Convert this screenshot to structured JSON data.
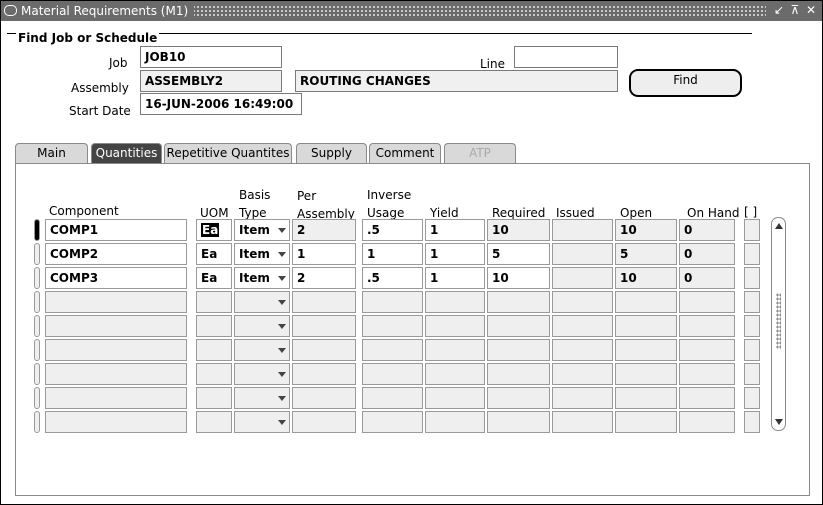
{
  "window": {
    "title": "Material Requirements (M1)",
    "controls": [
      "↙",
      "⊼",
      "✕"
    ]
  },
  "find_group": {
    "title": "Find Job or Schedule",
    "job_label": "Job",
    "job_value": "JOB10",
    "line_label": "Line",
    "line_value": "",
    "assembly_label": "Assembly",
    "assembly_value": "ASSEMBLY2",
    "assembly_desc": "ROUTING CHANGES",
    "start_date_label": "Start Date",
    "start_date_value": "16-JUN-2006 16:49:00",
    "find_button": "Find"
  },
  "tabs": [
    {
      "label": "Main",
      "state": "normal"
    },
    {
      "label": "Quantities",
      "state": "active"
    },
    {
      "label": "Repetitive Quantites",
      "state": "normal"
    },
    {
      "label": "Supply",
      "state": "normal"
    },
    {
      "label": "Comment",
      "state": "normal"
    },
    {
      "label": "ATP",
      "state": "disabled"
    }
  ],
  "table": {
    "headers": {
      "component": "Component",
      "uom": "UOM",
      "basis_type_1": "Basis",
      "basis_type_2": "Type",
      "per_assembly_1": "Per",
      "per_assembly_2": "Assembly",
      "inverse_usage_1": "Inverse",
      "inverse_usage_2": "Usage",
      "yield": "Yield",
      "required": "Required",
      "issued": "Issued",
      "open": "Open",
      "on_hand": "On Hand",
      "flex": "[ ]"
    },
    "rows": [
      {
        "component": "COMP1",
        "uom": "Ea",
        "basis_type": "Item",
        "per_assembly": "2",
        "inverse_usage": ".5",
        "yield": "1",
        "required": "10",
        "issued": "",
        "open": "10",
        "on_hand": "0"
      },
      {
        "component": "COMP2",
        "uom": "Ea",
        "basis_type": "Item",
        "per_assembly": "1",
        "inverse_usage": "1",
        "yield": "1",
        "required": "5",
        "issued": "",
        "open": "5",
        "on_hand": "0"
      },
      {
        "component": "COMP3",
        "uom": "Ea",
        "basis_type": "Item",
        "per_assembly": "2",
        "inverse_usage": ".5",
        "yield": "1",
        "required": "10",
        "issued": "",
        "open": "10",
        "on_hand": "0"
      }
    ],
    "empty_rows": 6
  },
  "colors": {
    "titlebar": "#6b6b6b",
    "active_tab": "#444444",
    "readonly_field": "#efefef"
  }
}
